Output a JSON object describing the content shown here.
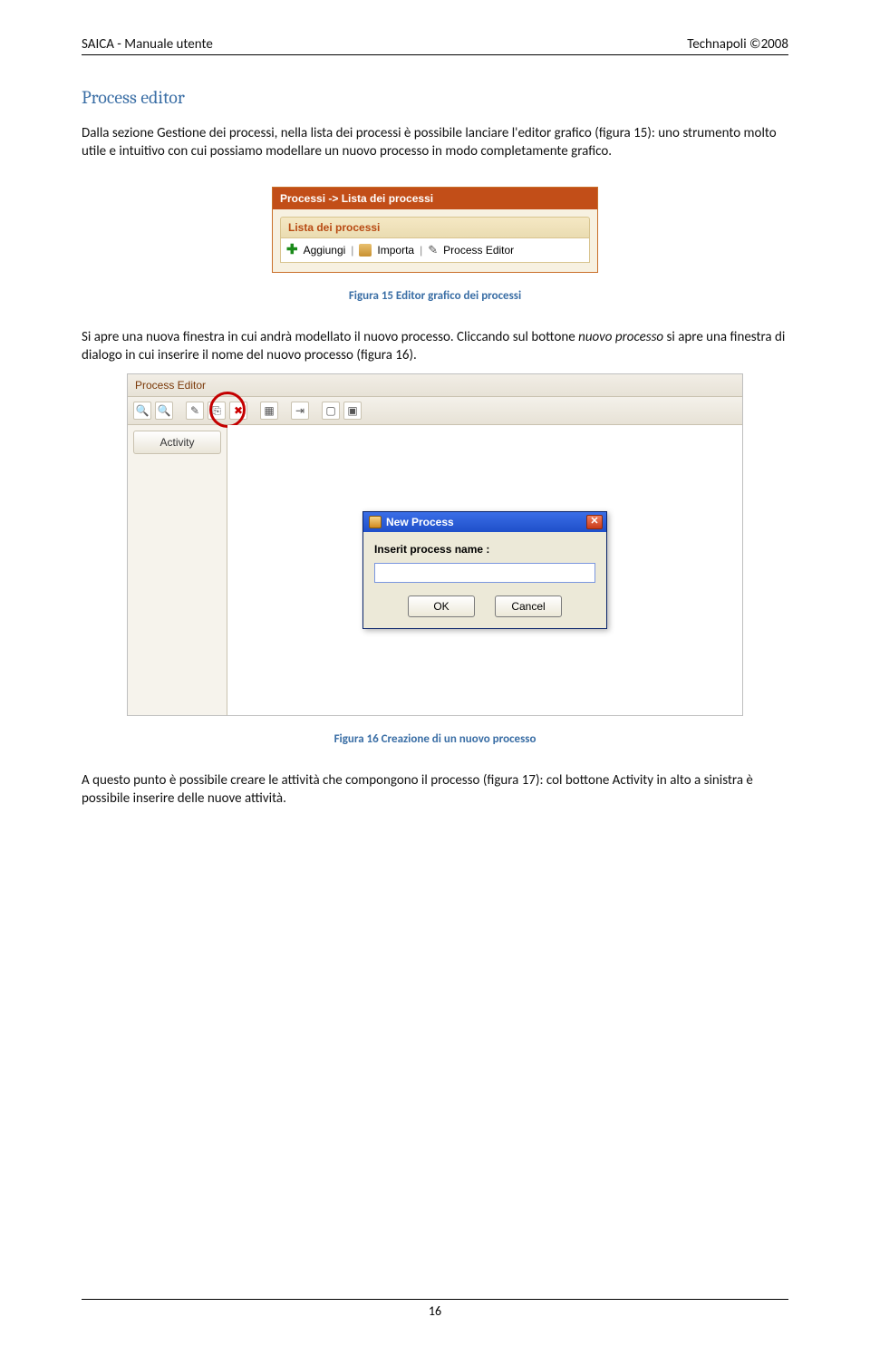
{
  "header": {
    "left": "SAICA - Manuale utente",
    "right": "Technapoli ©2008"
  },
  "section_title": "Process editor",
  "para1_a": "Dalla sezione Gestione dei processi, nella lista dei processi è possibile lanciare l'editor grafico (figura 15): uno strumento molto utile e intuitivo con cui possiamo modellare un nuovo processo in modo completamente grafico.",
  "fig15": {
    "window_title": "Processi -> Lista dei processi",
    "panel_title": "Lista dei processi",
    "aggiungi": "Aggiungi",
    "importa": "Importa",
    "process_editor": "Process Editor",
    "caption": "Figura 15 Editor grafico dei processi"
  },
  "para2_a": "Si apre una nuova finestra in cui andrà modellato il nuovo processo. Cliccando sul bottone ",
  "para2_b": "nuovo processo",
  "para2_c": " si apre una finestra di dialogo in cui inserire il nome del nuovo processo (figura 16).",
  "fig16": {
    "pe_title": "Process Editor",
    "activity": "Activity",
    "dialog_title": "New Process",
    "dialog_label": "Inserit process name :",
    "ok": "OK",
    "cancel": "Cancel",
    "caption": "Figura 16 Creazione di un nuovo processo"
  },
  "para3": "A questo punto è possibile creare le attività che compongono il processo (figura 17): col bottone Activity in alto a sinistra è possibile inserire delle nuove attività.",
  "page_number": "16"
}
